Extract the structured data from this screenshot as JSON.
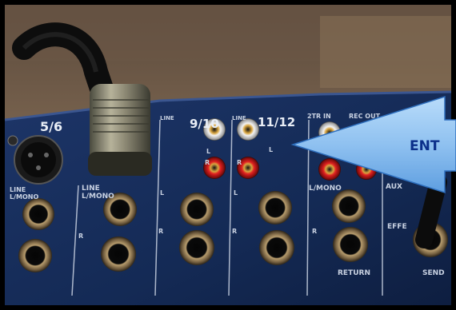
{
  "photo": {
    "channel_labels": {
      "ch56": "5/6",
      "ch910": "9/10",
      "ch1112": "11/12",
      "two_tr_in": "2TR IN",
      "rec_out": "REC OUT",
      "line": "LINE",
      "l_mono": "L/MONO",
      "aux": "AUX",
      "return": "RETURN",
      "send": "SEND",
      "effects": "EFFE"
    },
    "side_markers": {
      "l": "L",
      "r": "R"
    }
  },
  "callout": {
    "text": "ENT",
    "colors": {
      "fill": "#8fc1f0",
      "stroke": "#2e6fbe",
      "text": "#0b2f8a"
    }
  },
  "colors": {
    "panel": "#152a55",
    "background": "#000000"
  }
}
